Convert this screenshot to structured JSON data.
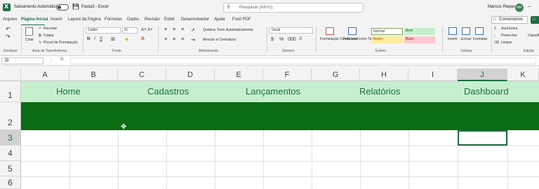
{
  "titlebar": {
    "autosave_label": "Salvamento Automático",
    "doc_title": "Pasta3 - Excel",
    "search_placeholder": "Pesquisar (Alt+G)",
    "user_name": "Marcos Rieper",
    "user_initials": "MR"
  },
  "menu": {
    "items": [
      "Arquivo",
      "Página Inicial",
      "Inserir",
      "Layout da Página",
      "Fórmulas",
      "Dados",
      "Revisão",
      "Exibir",
      "Desenvolvedor",
      "Ajuda",
      "Foxit PDF"
    ],
    "active": "Página Inicial",
    "comments_label": "Comentários"
  },
  "ribbon": {
    "groups": [
      "Desfazer",
      "Área de Transferência",
      "Fonte",
      "Alinhamento",
      "Número",
      "Estilos",
      "Células",
      "Edição"
    ],
    "paste": "Colar",
    "cut": "Recortar",
    "copy": "Copiar",
    "format_painter": "Pincel de Formatação",
    "font_name": "Calibri",
    "font_size": "11",
    "wrap_text": "Quebrar Texto Automaticamente",
    "merge_center": "Mesclar e Centralizar",
    "number_format": "Geral",
    "cond_format": "Formatação Condicional",
    "format_table": "Formatar como Tabela",
    "styles": {
      "normal": "Normal",
      "bom": "Bom",
      "neutro": "Neutro",
      "ruim": "Ruim"
    },
    "insert": "Inserir",
    "delete": "Excluir",
    "format": "Formatar",
    "autosum": "AutoSoma",
    "fill": "Preencher",
    "clear": "Limpar",
    "sort": "Classificar e Filtrar"
  },
  "formula_bar": {
    "cell_ref": "J3"
  },
  "columns": [
    "A",
    "B",
    "C",
    "D",
    "E",
    "F",
    "G",
    "H",
    "I",
    "J",
    "K"
  ],
  "rows": [
    "1",
    "2",
    "3",
    "4",
    "5",
    "6"
  ],
  "nav_links": [
    "Home",
    "Cadastros",
    "Lançamentos",
    "Relatórios",
    "Dashboard"
  ],
  "colors": {
    "nav_bg": "#c6efce",
    "nav_text": "#1d6f42",
    "band": "#0a6c12",
    "accent": "#1d6f42"
  }
}
